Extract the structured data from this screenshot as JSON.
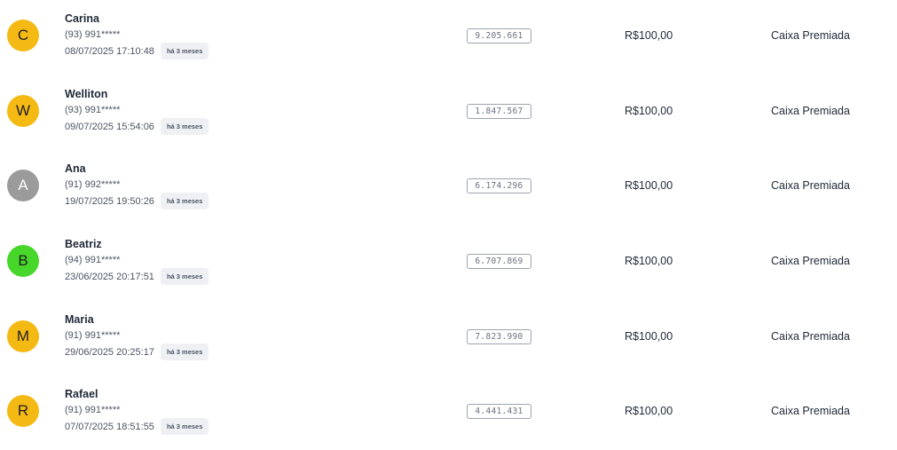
{
  "colors": {
    "yellow": "#F5B914",
    "gray": "#9B9B9B",
    "green": "#47D62A"
  },
  "rows": [
    {
      "initial": "C",
      "avatar_color": "#F5B914",
      "name": "Carina",
      "phone": "(93) 991*****",
      "datetime": "08/07/2025 17:10:48",
      "ago": "há 3 meses",
      "ticket": "9.205.661",
      "amount": "R$100,00",
      "prize": "Caixa Premiada"
    },
    {
      "initial": "W",
      "avatar_color": "#F5B914",
      "name": "Welliton",
      "phone": "(93) 991*****",
      "datetime": "09/07/2025 15:54:06",
      "ago": "há 3 meses",
      "ticket": "1.847.567",
      "amount": "R$100,00",
      "prize": "Caixa Premiada"
    },
    {
      "initial": "A",
      "avatar_color": "#9B9B9B",
      "name": "Ana",
      "phone": "(91) 992*****",
      "datetime": "19/07/2025 19:50:26",
      "ago": "há 3 meses",
      "ticket": "6.174.296",
      "amount": "R$100,00",
      "prize": "Caixa Premiada"
    },
    {
      "initial": "B",
      "avatar_color": "#47D62A",
      "name": "Beatriz",
      "phone": "(94) 991*****",
      "datetime": "23/06/2025 20:17:51",
      "ago": "há 3 meses",
      "ticket": "6.707.869",
      "amount": "R$100,00",
      "prize": "Caixa Premiada"
    },
    {
      "initial": "M",
      "avatar_color": "#F5B914",
      "name": "Maria",
      "phone": "(91) 991*****",
      "datetime": "29/06/2025 20:25:17",
      "ago": "há 3 meses",
      "ticket": "7.823.990",
      "amount": "R$100,00",
      "prize": "Caixa Premiada"
    },
    {
      "initial": "R",
      "avatar_color": "#F5B914",
      "name": "Rafael",
      "phone": "(91) 991*****",
      "datetime": "07/07/2025 18:51:55",
      "ago": "há 3 meses",
      "ticket": "4.441.431",
      "amount": "R$100,00",
      "prize": "Caixa Premiada"
    }
  ]
}
